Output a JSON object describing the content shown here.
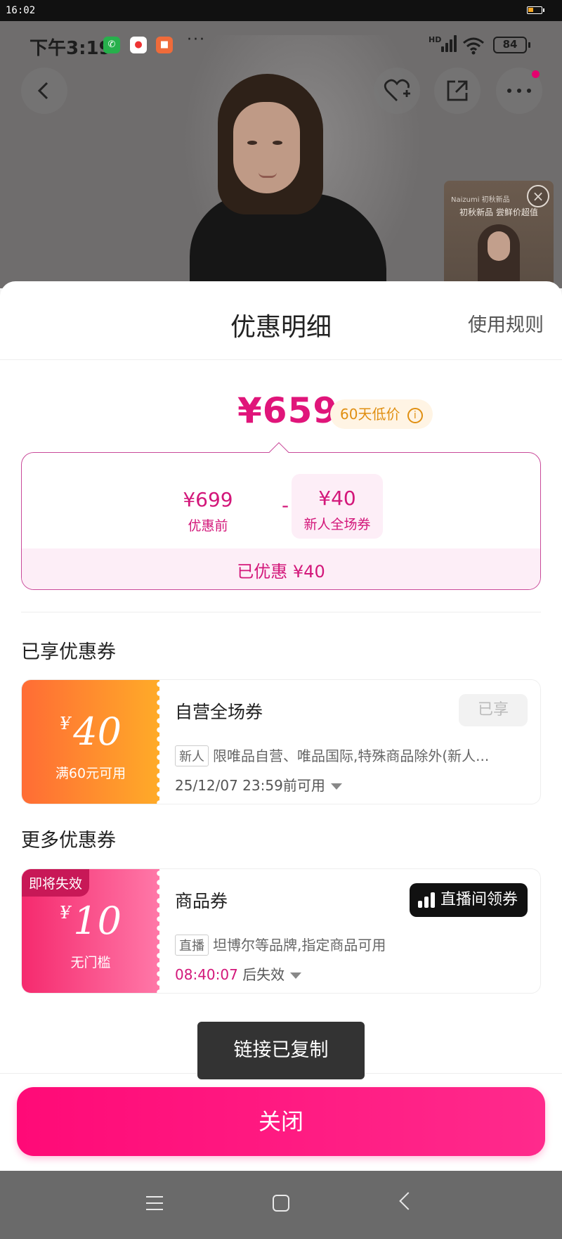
{
  "system_bar": {
    "time": "16:02"
  },
  "phone_status": {
    "clock": "下午3:19",
    "network": "HD",
    "battery": "84"
  },
  "hero": {
    "live_thumb": {
      "line1": "Naizumi 初秋新品",
      "line2": "初秋新品 尝鲜价超值"
    }
  },
  "sheet": {
    "title": "优惠明细",
    "rules_link": "使用规则",
    "final_price": "¥659",
    "low_price_tag": "60天低价",
    "calc": {
      "original_amount": "¥699",
      "original_label": "优惠前",
      "minus": "-",
      "discount_amount": "¥40",
      "discount_label": "新人全场券",
      "saved": "已优惠 ¥40"
    },
    "section_used": "已享优惠券",
    "section_more": "更多优惠券",
    "coupons": [
      {
        "yen": "¥",
        "value": "40",
        "condition": "满60元可用",
        "name": "自营全场券",
        "chip": "新人",
        "desc": "限唯品自营、唯品国际,特殊商品除外(新人...",
        "time": "25/12/07 23:59前可用",
        "badge": "已享"
      },
      {
        "expire_tag": "即将失效",
        "yen": "¥",
        "value": "10",
        "condition": "无门槛",
        "name": "商品券",
        "chip": "直播",
        "desc": "坦博尔等品牌,指定商品可用",
        "countdown": "08:40:07",
        "time_suffix": "后失效",
        "action": "直播间领券"
      }
    ],
    "toast": "链接已复制",
    "close_button": "关闭"
  },
  "colors": {
    "accent": "#e0157a",
    "primary_button": "#ff0a77",
    "orange_coupon": "#ff6c35",
    "pink_coupon": "#f52a6e"
  }
}
